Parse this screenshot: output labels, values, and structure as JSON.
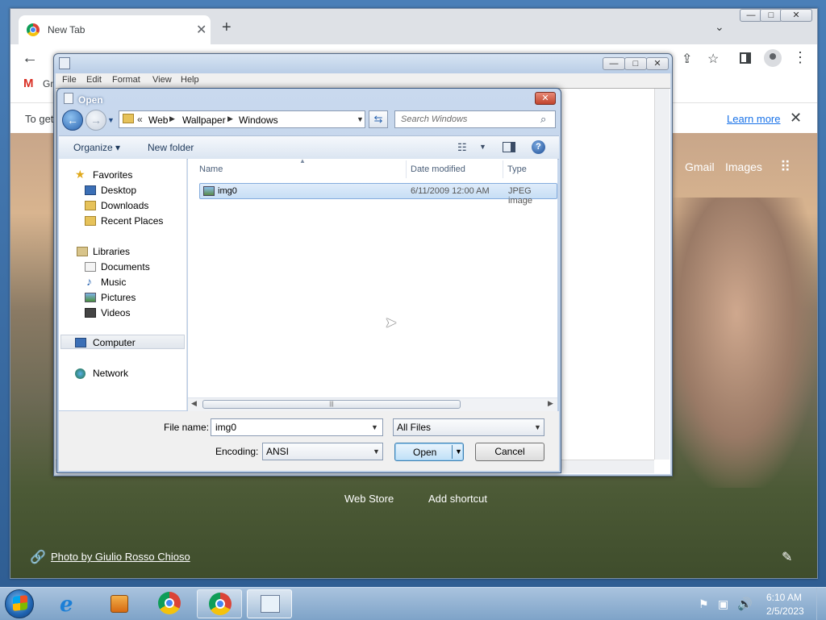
{
  "chrome": {
    "tab_title": "New Tab",
    "tab_close": "✕",
    "new_tab": "+",
    "tab_search": "⌄",
    "bookmark_gmail_label": "Gm",
    "infobar_text": "To get",
    "learn_more": "Learn more",
    "ntp": {
      "gmail": "Gmail",
      "images": "Images",
      "web_store": "Web Store",
      "add_shortcut": "Add shortcut",
      "photo_credit": "Photo by Giulio Rosso Chioso"
    }
  },
  "notepad": {
    "menu": [
      "File",
      "Edit",
      "Format",
      "View",
      "Help"
    ]
  },
  "open_dialog": {
    "title": "Open",
    "breadcrumb": [
      "Web",
      "Wallpaper",
      "Windows"
    ],
    "search_placeholder": "Search Windows",
    "organize": "Organize",
    "new_folder": "New folder",
    "nav": {
      "favorites": "Favorites",
      "desktop": "Desktop",
      "downloads": "Downloads",
      "recent_places": "Recent Places",
      "libraries": "Libraries",
      "documents": "Documents",
      "music": "Music",
      "pictures": "Pictures",
      "videos": "Videos",
      "computer": "Computer",
      "network": "Network"
    },
    "columns": [
      "Name",
      "Date modified",
      "Type"
    ],
    "files": [
      {
        "name": "img0",
        "date_modified": "6/11/2009 12:00 AM",
        "type": "JPEG image"
      }
    ],
    "file_name_label": "File name:",
    "file_name_value": "img0",
    "filter_value": "All Files",
    "encoding_label": "Encoding:",
    "encoding_value": "ANSI",
    "open_button": "Open",
    "cancel_button": "Cancel"
  },
  "taskbar": {
    "clock_time": "6:10 AM",
    "clock_date": "2/5/2023"
  }
}
